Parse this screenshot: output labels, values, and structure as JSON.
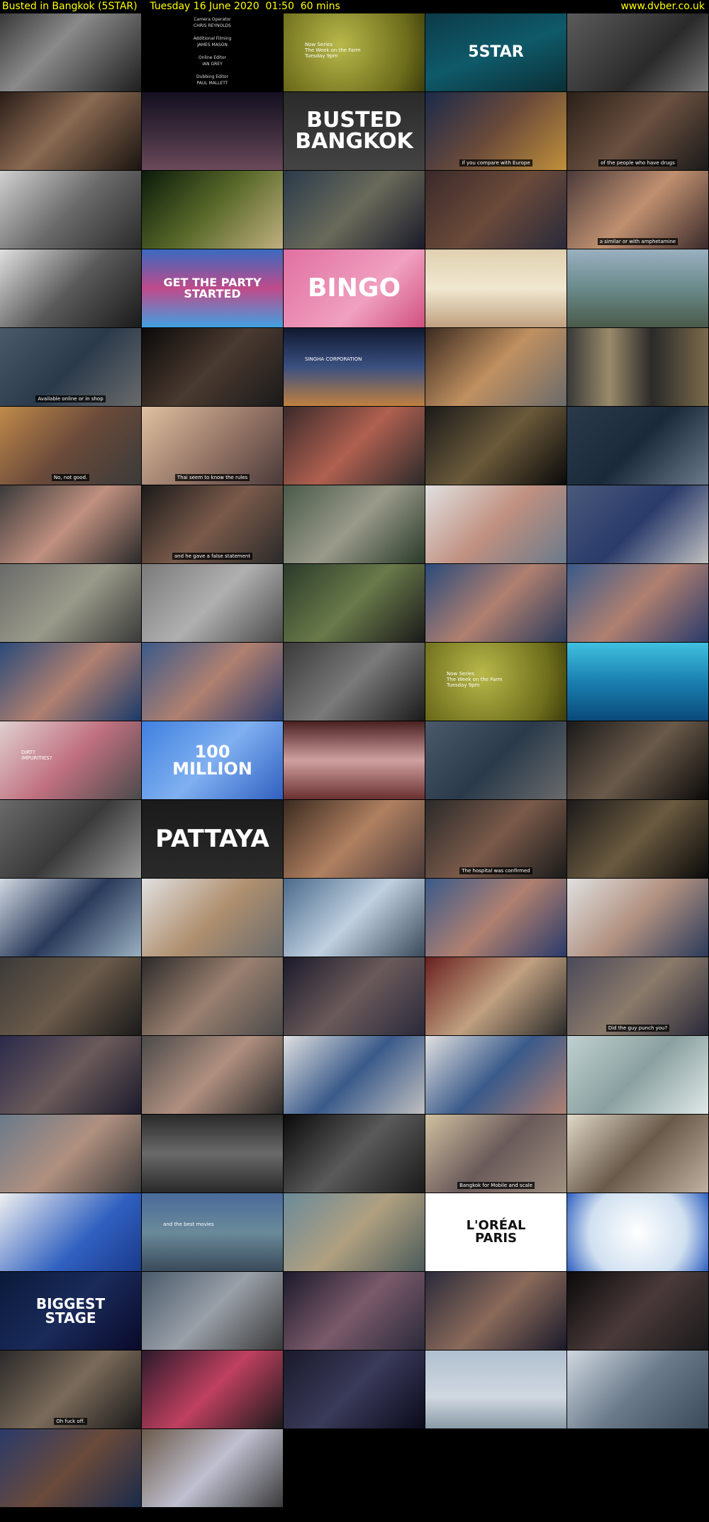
{
  "header": {
    "title": "Busted in Bangkok (5STAR)    Tuesday 16 June 2020  01:50  60 mins",
    "site": "www.dvber.co.uk"
  },
  "colors": {
    "header_text": "#ffff00",
    "background": "#000000"
  },
  "thumbnails": [
    {
      "bg": "linear-gradient(135deg,#3a3a3a,#8a8a8a 40%,#1f1f1f)"
    },
    {
      "bg": "#000",
      "credits": "Camera Operator\nCHRIS REYNOLDS\n\nAdditional Filming\nJAMES MASON\n\nOnline Editor\nIAN GREY\n\nDubbing Editor\nPAUL MALLETT\n\nDubbing Mixer\nMARK APPICELLA"
    },
    {
      "bg": "radial-gradient(circle at 40% 40%,#b8b84a,#6d6d1c 70%,#3d3d0c)",
      "small": "Now Series\nThe Week on the Farm\nTuesday 9pm"
    },
    {
      "bg": "linear-gradient(160deg,#0c3b48,#0f5a6a 50%,#0a2f36)",
      "big": "5STAR",
      "big_size": 22
    },
    {
      "bg": "linear-gradient(135deg,#5b5b5b,#2a2a2a 60%,#777)"
    },
    {
      "bg": "linear-gradient(135deg,#2a1e18,#8a6a52 45%,#1a1410)"
    },
    {
      "bg": "linear-gradient(180deg,#141020,#3a2a3a 50%,#6a4a5a)"
    },
    {
      "bg": "linear-gradient(180deg,#2a2a2a,#444)",
      "big": "BUSTED\nBANGKOK",
      "big_size": 30
    },
    {
      "bg": "linear-gradient(135deg,#1b2a4a,#6a4a3a 50%,#c0903a)",
      "cap": "if you compare with Europe"
    },
    {
      "bg": "linear-gradient(135deg,#2a2018,#6a5040 50%,#1a1a1a)",
      "cap": "of the people who have drugs"
    },
    {
      "bg": "linear-gradient(135deg,#d0d0d0,#6a6a6a 50%,#2a2a2a)"
    },
    {
      "bg": "linear-gradient(135deg,#0a1a0a,#5a6a2a 50%,#c0b080)"
    },
    {
      "bg": "linear-gradient(135deg,#2a3a4a,#6a6a5a 50%,#1a1a2a)"
    },
    {
      "bg": "linear-gradient(135deg,#3a2a2a,#6a4a3a 50%,#2a2a3a)"
    },
    {
      "bg": "linear-gradient(135deg,#4a3a3a,#c09070 50%,#3a2a2a)",
      "cap": "a similar or with amphetamine"
    },
    {
      "bg": "linear-gradient(135deg,#e0e0e0,#5a5a5a 50%,#1a1a1a)"
    },
    {
      "bg": "linear-gradient(180deg,#3a6ac0,#c04a8a 50%,#40a0e0)",
      "big": "GET THE PARTY\nSTARTED",
      "big_size": 16
    },
    {
      "bg": "linear-gradient(135deg,#e070a0,#f0a0c0 60%,#d05080)",
      "big": "BINGO",
      "big_size": 36
    },
    {
      "bg": "linear-gradient(180deg,#e0d0b0,#f0e8d0 50%,#c0a080)"
    },
    {
      "bg": "linear-gradient(180deg,#9ab0c0,#6a8a8a 50%,#4a5a4a)"
    },
    {
      "bg": "linear-gradient(135deg,#4a5a6a,#2a3a4a 50%,#6a6a6a)",
      "cap": "Available online or in shop"
    },
    {
      "bg": "linear-gradient(135deg,#0a0a0a,#4a3a30 50%,#1a1a1a)"
    },
    {
      "bg": "linear-gradient(180deg,#101830,#3a5080 50%,#c08040)",
      "small": "SINGHA CORPORATION"
    },
    {
      "bg": "linear-gradient(135deg,#3a2a20,#c09060 50%,#6a6a6a)"
    },
    {
      "bg": "linear-gradient(90deg,#3a3a3a,#9a8a6a 30%,#2a2a2a 60%,#7a6a4a)"
    },
    {
      "bg": "linear-gradient(135deg,#c08a4a,#6a4a3a 50%,#3a3a3a)",
      "cap": "No, not good."
    },
    {
      "bg": "linear-gradient(135deg,#e0c0a0,#9a7a6a 50%,#4a3a3a)",
      "cap": "Thai seem to know the rules"
    },
    {
      "bg": "linear-gradient(135deg,#3a2a2a,#b06050 50%,#2a2a2a)"
    },
    {
      "bg": "linear-gradient(135deg,#1a1a1a,#6a5a3a 50%,#0a0a0a)"
    },
    {
      "bg": "linear-gradient(135deg,#2a3a4a,#1a2a3a 50%,#6a7a8a)"
    },
    {
      "bg": "linear-gradient(135deg,#3a3a3a,#c09080 50%,#2a2a2a)"
    },
    {
      "bg": "linear-gradient(135deg,#1a1a1a,#7a5a4a 50%,#2a2a2a)",
      "cap": "and he gave a false statement"
    },
    {
      "bg": "linear-gradient(135deg,#4a5a4a,#9a9a8a 50%,#2a3a2a)"
    },
    {
      "bg": "linear-gradient(135deg,#e0e0e0,#c09080 50%,#6a7a8a)"
    },
    {
      "bg": "linear-gradient(135deg,#4a5a7a,#2a3a6a 50%,#c0c0c0)"
    },
    {
      "bg": "linear-gradient(135deg,#6a6a6a,#9a9a8a 50%,#3a3a3a)"
    },
    {
      "bg": "linear-gradient(135deg,#7a7a7a,#b0b0b0 50%,#4a4a4a)"
    },
    {
      "bg": "linear-gradient(135deg,#2a3a2a,#6a7a4a 50%,#1a1a1a)"
    },
    {
      "bg": "linear-gradient(135deg,#2a4a7a,#b08070 50%,#2a3a5a)"
    },
    {
      "bg": "linear-gradient(135deg,#3a5a8a,#b08070 50%,#2a3a6a)"
    },
    {
      "bg": "linear-gradient(135deg,#2a4a7a,#b08070 50%,#1a3a6a)"
    },
    {
      "bg": "linear-gradient(135deg,#3a5a8a,#b08070 50%,#2a3a6a)"
    },
    {
      "bg": "linear-gradient(135deg,#3a3a3a,#7a7a7a 50%,#1a1a1a)"
    },
    {
      "bg": "radial-gradient(circle at 40% 40%,#b8b84a,#6d6d1c 70%,#3d3d0c)",
      "small": "Now Series\nThe Week on the Farm\nTuesday 9pm"
    },
    {
      "bg": "linear-gradient(180deg,#40c0e0,#1a80b0 50%,#0a4a7a)"
    },
    {
      "bg": "linear-gradient(135deg,#e0d0d0,#c07080 50%,#4a4a4a)",
      "small": "DIRT?\nIMPURITIES?"
    },
    {
      "bg": "linear-gradient(135deg,#4080e0,#80b0f0 50%,#3060c0)",
      "big": "100\nMILLION",
      "big_size": 24
    },
    {
      "bg": "linear-gradient(180deg,#4a2020,#d0a0a0 50%,#6a3030)"
    },
    {
      "bg": "linear-gradient(135deg,#4a5a6a,#2a3a4a 50%,#6a6a6a)"
    },
    {
      "bg": "linear-gradient(135deg,#1a1a1a,#6a5a4a 50%,#0a0a0a)"
    },
    {
      "bg": "linear-gradient(135deg,#6a6a6a,#3a3a3a 50%,#9a9a9a)"
    },
    {
      "bg": "linear-gradient(180deg,#1a1a1a,#2a2a2a)",
      "big": "PATTAYA",
      "big_size": 34
    },
    {
      "bg": "linear-gradient(135deg,#3a2a20,#b08060 50%,#4a3a3a)"
    },
    {
      "bg": "linear-gradient(135deg,#2a2a2a,#7a5a4a 50%,#1a1a1a)",
      "cap": "The hospital was confirmed"
    },
    {
      "bg": "linear-gradient(135deg,#1a1a1a,#6a5a40 50%,#0a0a0a)"
    },
    {
      "bg": "linear-gradient(135deg,#d0d8e0,#2a3a5a 50%,#9ab0c0)"
    },
    {
      "bg": "linear-gradient(135deg,#e0e0e0,#b09070 50%,#6a6a6a)"
    },
    {
      "bg": "linear-gradient(135deg,#4a6a8a,#c0d0e0 50%,#3a4a5a)"
    },
    {
      "bg": "linear-gradient(135deg,#3a5a8a,#b08070 50%,#2a3a6a)"
    },
    {
      "bg": "linear-gradient(135deg,#e0e0e0,#b09080 50%,#2a3a5a)"
    },
    {
      "bg": "linear-gradient(135deg,#3a3a3a,#6a5a4a 50%,#1a1a1a)"
    },
    {
      "bg": "linear-gradient(135deg,#2a2a2a,#9a8070 50%,#4a4a4a)"
    },
    {
      "bg": "linear-gradient(135deg,#1a1a2a,#6a5a5a 50%,#2a2a3a)"
    },
    {
      "bg": "linear-gradient(135deg,#6a2020,#c0a080 50%,#2a2a2a)"
    },
    {
      "bg": "linear-gradient(135deg,#4a4a5a,#8a7a6a 50%,#2a2a3a)",
      "cap": "Did the guy punch you?"
    },
    {
      "bg": "linear-gradient(135deg,#2a2a4a,#6a5a5a 50%,#1a1a2a)"
    },
    {
      "bg": "linear-gradient(135deg,#4a4a4a,#b09080 50%,#2a2a2a)"
    },
    {
      "bg": "linear-gradient(135deg,#e0e0e0,#3a5a8a 50%,#c0c0c0)"
    },
    {
      "bg": "linear-gradient(135deg,#e0e0e0,#3a5a8a 50%,#b08070)"
    },
    {
      "bg": "linear-gradient(135deg,#c0d0d0,#8aa0a0 50%,#e0e8e8)"
    },
    {
      "bg": "linear-gradient(135deg,#6a7a8a,#b09080 50%,#3a3a3a)"
    },
    {
      "bg": "linear-gradient(180deg,#2a2a2a,#6a6a6a 50%,#2a2a2a)"
    },
    {
      "bg": "linear-gradient(135deg,#0a0a0a,#5a5a5a 50%,#1a1a1a)"
    },
    {
      "bg": "linear-gradient(135deg,#d0c0a0,#6a5a5a 50%,#a09080)",
      "cap": "Bangkok for Mobile and scale"
    },
    {
      "bg": "linear-gradient(135deg,#e0d8c8,#6a5a4a 50%,#c0b0a0)"
    },
    {
      "bg": "linear-gradient(135deg,#f0f0f0,#3060c0 60%,#1a3a8a)"
    },
    {
      "bg": "linear-gradient(180deg,#4a6a9a,#6a8a9a 50%,#3a4a5a)",
      "small": "and the best movies"
    },
    {
      "bg": "linear-gradient(135deg,#6a8a9a,#b0a080 50%,#4a5a5a)"
    },
    {
      "bg": "#fff",
      "big": "L'ORÉAL\nPARIS",
      "big_size": 18,
      "big_color": "#111"
    },
    {
      "bg": "radial-gradient(circle at 50% 50%,#ffffff,#d0e0f0 60%,#3060c0)"
    },
    {
      "bg": "linear-gradient(135deg,#0a1a3a,#1a2a5a 50%,#0a0a2a)",
      "big": "BIGGEST\nSTAGE",
      "big_size": 20
    },
    {
      "bg": "linear-gradient(135deg,#4a5a6a,#9aa0a8 50%,#3a3a3a)"
    },
    {
      "bg": "linear-gradient(135deg,#1a1a2a,#7a5a6a 50%,#2a2a3a)"
    },
    {
      "bg": "linear-gradient(135deg,#2a2a3a,#8a6a5a 50%,#1a1a2a)"
    },
    {
      "bg": "linear-gradient(135deg,#0a0a0a,#4a3a3a 50%,#1a1a1a)"
    },
    {
      "bg": "linear-gradient(135deg,#2a2a2a,#7a6a5a 50%,#1a1a1a)",
      "cap": "Oh fuck off."
    },
    {
      "bg": "linear-gradient(135deg,#2a1a2a,#c04060 50%,#1a1a1a)"
    },
    {
      "bg": "linear-gradient(135deg,#1a1a2a,#3a3a5a 50%,#0a0a1a)"
    },
    {
      "bg": "linear-gradient(180deg,#b0c0d0,#d0d8e0 60%,#8a9aa8)"
    },
    {
      "bg": "linear-gradient(135deg,#d0d8e0,#6a7a8a 50%,#3a4a5a)"
    },
    {
      "bg": "linear-gradient(135deg,#2a3a6a,#6a4a3a 50%,#1a2a4a)"
    },
    {
      "bg": "linear-gradient(135deg,#6a5a4a,#c0c0d0 50%,#3a3a3a)"
    }
  ]
}
